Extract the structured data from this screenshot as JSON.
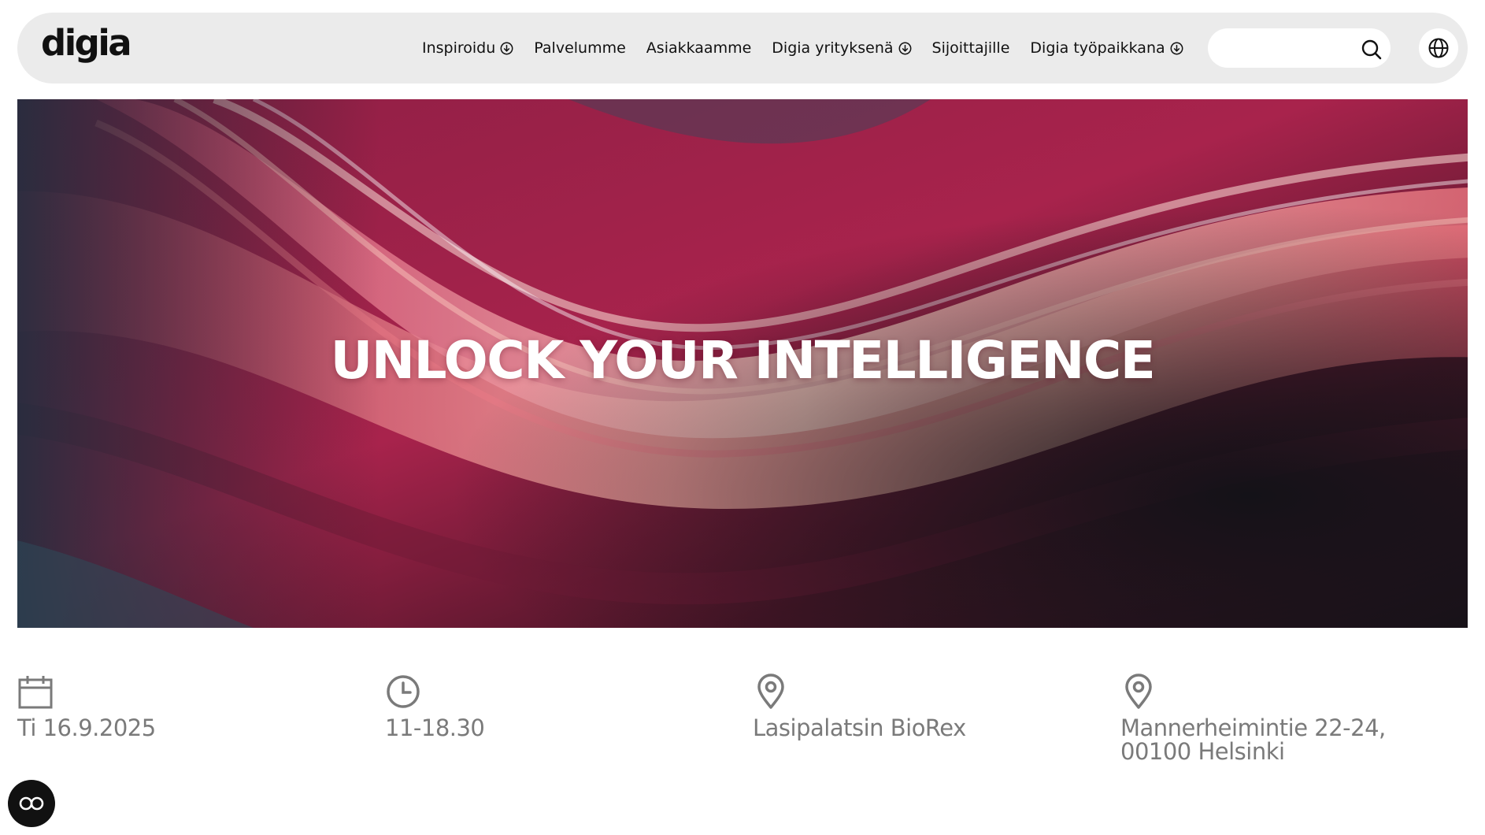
{
  "header": {
    "logo": "digia",
    "nav": [
      {
        "label": "Inspiroidu",
        "has_dropdown": true
      },
      {
        "label": "Palvelumme",
        "has_dropdown": false
      },
      {
        "label": "Asiakkaamme",
        "has_dropdown": false
      },
      {
        "label": "Digia yrityksenä",
        "has_dropdown": true
      },
      {
        "label": "Sijoittajille",
        "has_dropdown": false
      },
      {
        "label": "Digia työpaikkana",
        "has_dropdown": true
      }
    ],
    "search": {
      "value": "",
      "placeholder": ""
    },
    "icons": {
      "search": "search-icon",
      "language": "globe-icon",
      "dropdown": "chevron-down-circle-icon"
    }
  },
  "hero": {
    "title": "UNLOCK YOUR INTELLIGENCE"
  },
  "event": {
    "date": "Ti 16.9.2025",
    "time": "11-18.30",
    "venue": "Lasipalatsin BioRex",
    "address_line1": "Mannerheimintie 22-24,",
    "address_line2": "00100 Helsinki",
    "icons": {
      "date": "calendar-icon",
      "time": "clock-icon",
      "venue": "map-pin-icon",
      "address": "map-pin-icon"
    }
  },
  "accessibility": {
    "icon": "accessibility-icon"
  },
  "colors": {
    "header_bg": "#ebebeb",
    "info_text": "#7a7a7a",
    "hero_accent": "#c8284f"
  }
}
